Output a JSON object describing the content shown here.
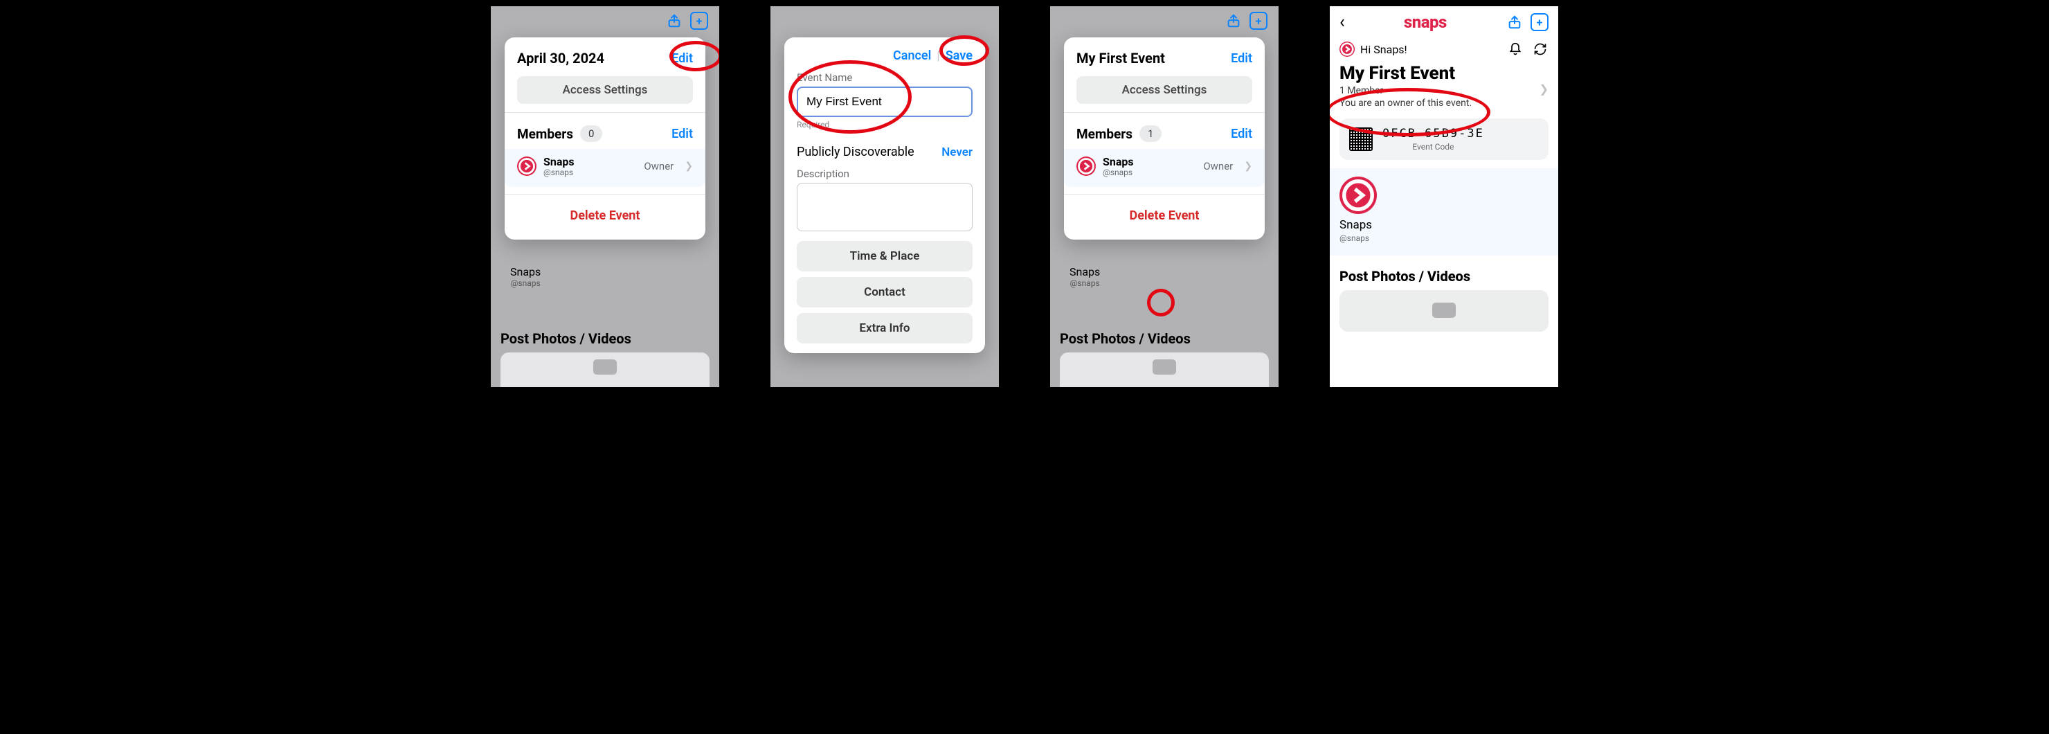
{
  "colors": {
    "accent": "#0a84ff",
    "danger": "#d62b2b",
    "brand": "#de234a"
  },
  "screen1": {
    "title": "April 30, 2024",
    "edit": "Edit",
    "access": "Access Settings",
    "members_label": "Members",
    "members_count": "0",
    "members_edit": "Edit",
    "member_name": "Snaps",
    "member_handle": "@snaps",
    "member_role": "Owner",
    "delete": "Delete Event",
    "bg_name": "Snaps",
    "bg_handle": "@snaps",
    "section": "Post Photos / Videos"
  },
  "screen2": {
    "cancel": "Cancel",
    "save": "Save",
    "name_label": "Event Name",
    "name_value": "My First Event",
    "required": "Required",
    "discover_label": "Publicly Discoverable",
    "discover_value": "Never",
    "desc_label": "Description",
    "btn_time": "Time & Place",
    "btn_contact": "Contact",
    "btn_extra": "Extra Info"
  },
  "screen3": {
    "title": "My First Event",
    "edit": "Edit",
    "access": "Access Settings",
    "members_label": "Members",
    "members_count": "1",
    "members_edit": "Edit",
    "member_name": "Snaps",
    "member_handle": "@snaps",
    "member_role": "Owner",
    "delete": "Delete Event",
    "bg_name": "Snaps",
    "bg_handle": "@snaps",
    "section": "Post Photos / Videos"
  },
  "screen4": {
    "brand": "snaps",
    "greeting": "Hi Snaps!",
    "event_title": "My First Event",
    "members_line": "1 Member",
    "owner_line": "You are an owner of this event.",
    "code": "0FCB-65B9-3E",
    "code_label": "Event Code",
    "owner_name": "Snaps",
    "owner_handle": "@snaps",
    "section": "Post Photos / Videos"
  }
}
